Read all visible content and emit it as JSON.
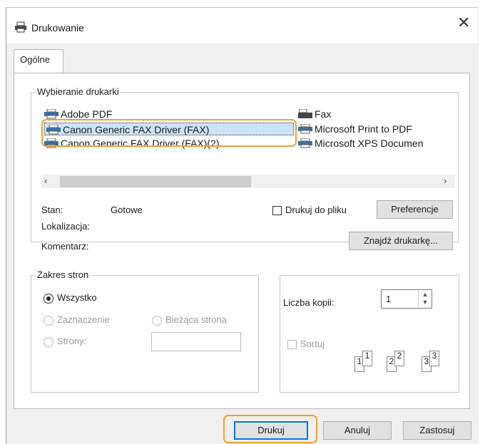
{
  "window": {
    "title": "Drukowanie"
  },
  "tabs": [
    "Ogólne"
  ],
  "printer_group": {
    "label": "Wybieranie drukarki",
    "printers_left": [
      "Adobe PDF",
      "Canon Generic FAX Driver (FAX)",
      "Canon Generic FAX Driver (FAX)(2)"
    ],
    "printers_right": [
      "Fax",
      "Microsoft Print to PDF",
      "Microsoft XPS Documen"
    ],
    "selected": "Canon Generic FAX Driver (FAX)"
  },
  "status": {
    "state_label": "Stan:",
    "state_value": "Gotowe",
    "location_label": "Lokalizacja:",
    "comment_label": "Komentarz:"
  },
  "print_to_file": {
    "label": "Drukuj do pliku",
    "checked": false
  },
  "buttons": {
    "preferences": "Preferencje",
    "find_printer": "Znajdź drukarkę...",
    "print": "Drukuj",
    "cancel": "Anuluj",
    "apply": "Zastosuj"
  },
  "page_range": {
    "label": "Zakres stron",
    "all": "Wszystko",
    "selection": "Zaznaczenie",
    "current_page": "Bieżąca strona",
    "pages": "Strony:",
    "pages_value": ""
  },
  "copies": {
    "label": "Liczba kopii:",
    "value": "1",
    "collate_label": "Sortuj",
    "collate_checked": false,
    "collate_pages": [
      "1",
      "1",
      "2",
      "2",
      "3",
      "3"
    ]
  },
  "colors": {
    "selection": "#cce4f7",
    "highlight": "#f0a030",
    "default_button_border": "#0078d7"
  }
}
